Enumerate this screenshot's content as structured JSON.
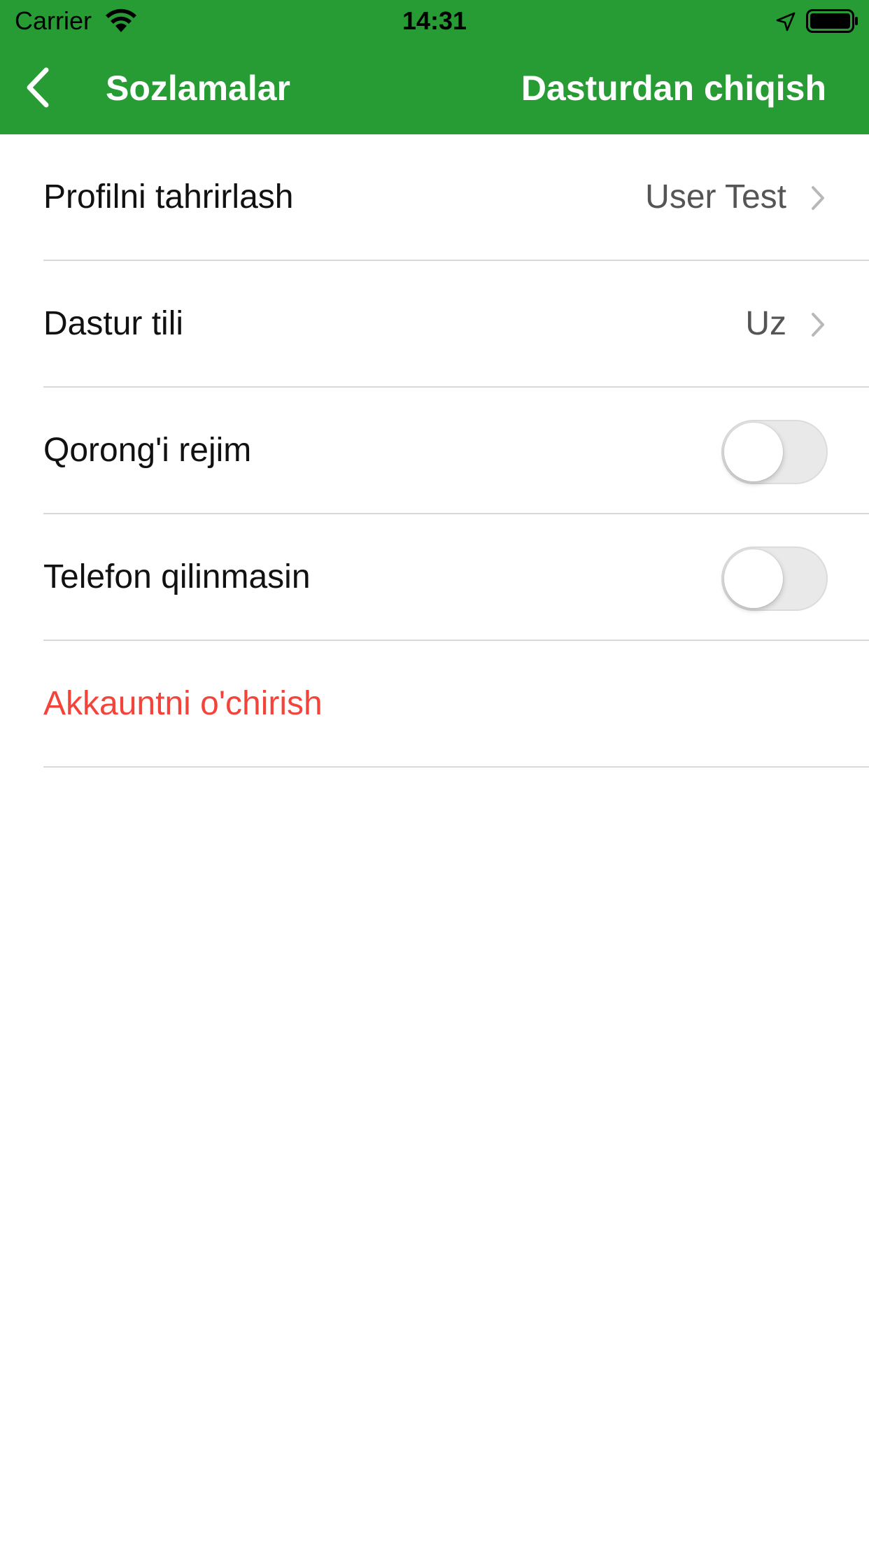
{
  "status_bar": {
    "carrier": "Carrier",
    "time": "14:31",
    "icons": [
      "wifi-icon",
      "location-arrow-icon",
      "battery-icon"
    ]
  },
  "nav": {
    "back_icon": "chevron-left-icon",
    "title": "Sozlamalar",
    "logout_label": "Dasturdan chiqish"
  },
  "colors": {
    "primary": "#279c34",
    "danger": "#f2443a",
    "separator": "#d9d9d9",
    "toggle_off": "#e9e9ea"
  },
  "settings": {
    "items": [
      {
        "label": "Profilni tahrirlash",
        "value": "User Test",
        "type": "link",
        "icon": "chevron-right-icon"
      },
      {
        "label": "Dastur tili",
        "value": "Uz",
        "type": "link",
        "icon": "chevron-right-icon"
      },
      {
        "label": "Qorong'i rejim",
        "type": "toggle",
        "on": false
      },
      {
        "label": "Telefon qilinmasin",
        "type": "toggle",
        "on": false
      },
      {
        "label": "Akkauntni o'chirish",
        "type": "danger"
      }
    ]
  }
}
